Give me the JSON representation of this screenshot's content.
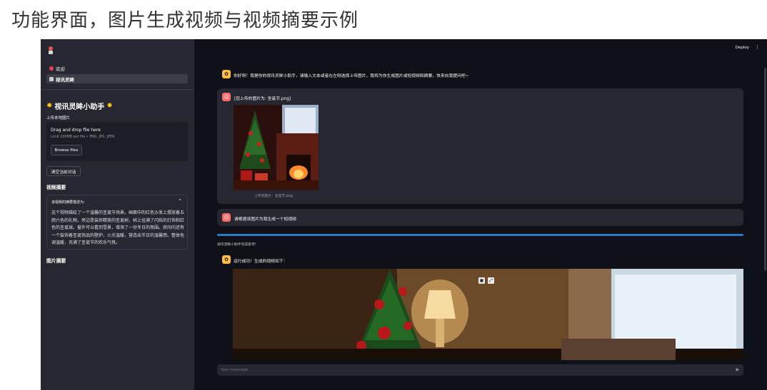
{
  "page_title": "功能界面，图片生成视频与视频摘要示例",
  "sidebar": {
    "nav_items": [
      {
        "label": "欢迎",
        "icon": "heart-icon"
      },
      {
        "label": "视讯灵眸",
        "icon": "bot-icon",
        "active": true
      }
    ],
    "app_title": "视讯灵眸小助手",
    "upload_label": "上传本地图片",
    "dropzone": {
      "title": "Drag and drop file here",
      "limit": "Limit 200MB per file • PNG, JPG, JPEG",
      "browse_label": "Browse files"
    },
    "clear_label": "清空当前对话",
    "video_summary_heading": "视频摘要",
    "summary_expander": {
      "header": "该视频的摘要描述为:",
      "text": "这个视频描绘了一个温馨的圣诞节场景。画面中的红色沙发上摆放着五颜六色的礼物，旁边是装饰精美的圣诞树，树上挂满了闪烁的灯饰和红色的圣诞球。窗外可以看到雪景，增添了一份冬日的氛围。房间内还有一个装饰着圣诞饰品的壁炉，火光温暖，营造出节日的温馨感。整体色调温暖，充满了圣诞节的欢乐气氛。"
    },
    "image_summary_heading": "图片摘要"
  },
  "header": {
    "deploy_label": "Deploy",
    "menu_icon": "kebab-menu-icon"
  },
  "chat": {
    "greeting": "你好呀！我是你的视讯灵眸小助手，请输入文本或者在左侧选择上传图片，我将为你生成图片或短视频和摘要，快来向我提问吧~",
    "uploaded_message": "[您上传的图片为: 圣诞节.png]",
    "image_caption": "上传的图片：圣诞节.png",
    "request_message": "请根据该图片为我生成一个短视频",
    "progress": {
      "value": 1.0,
      "label": "视讯灵眸小助手完成思考!"
    },
    "result_message": "运行成功！生成的视频如下："
  },
  "input": {
    "placeholder": "Your message"
  },
  "colors": {
    "app_bg": "#0e1117",
    "sidebar_bg": "#262730",
    "bot_avatar": "#ffbd45",
    "user_avatar": "#ff6b6b",
    "progress": "#2b78c9"
  }
}
